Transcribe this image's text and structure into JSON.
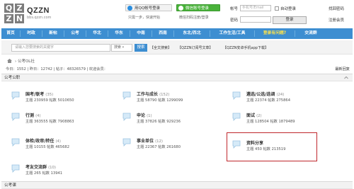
{
  "brand": {
    "logo_letters": [
      "Q",
      "Z",
      "Z",
      "N"
    ],
    "name": "QZZN",
    "url": "bbs.qzzn.com"
  },
  "social_login": {
    "qq_label": "用QQ帐号登录",
    "qq_note": "只需一步，快速开始",
    "wechat_label": "微信账号登录",
    "wechat_note": "微信扫码注册/登录"
  },
  "login_form": {
    "username_label": "帐号",
    "username_placeholder": "手机号/Email",
    "password_label": "密码",
    "auto_login_label": "自动登录",
    "submit_label": "登录",
    "forgot_password": "找回密码",
    "register": "注册会员"
  },
  "nav": {
    "items": [
      "首页",
      "时政",
      "新帖",
      "公考",
      "华北",
      "华东",
      "中南",
      "西南",
      "东北/西北",
      "工作生活/工具",
      "登录有问题?",
      "交流群"
    ]
  },
  "search": {
    "placeholder": "请输入您要搜索的关键字",
    "scope": "搜索",
    "button": "搜索",
    "links": [
      "【全文搜索】",
      "【QZZN订阅号文章】",
      "【QZZN安卓手机app下载】"
    ]
  },
  "breadcrumb": {
    "current": "公考OL社"
  },
  "stats": {
    "text": "今日：1552 | 昨日：12742 | 帖子：48326579 | 欢迎会员：",
    "hot": "最新回复"
  },
  "group": {
    "title": "公考公职",
    "next_title": "公考课"
  },
  "forums": [
    {
      "name": "国考/联考",
      "count": "(35)",
      "stats": "主题 230959  帖数 5010650"
    },
    {
      "name": "工作与成长",
      "count": "(152)",
      "stats": "主题 58790  帖数 1299099"
    },
    {
      "name": "遴选/公选/选调",
      "count": "(24)",
      "stats": "主题 22374  帖数 275864"
    },
    {
      "name": "行测",
      "count": "(4)",
      "stats": "主题 363555  帖数 7908863"
    },
    {
      "name": "申论",
      "count": "(1)",
      "stats": "主题 37826  帖数 929236"
    },
    {
      "name": "面试",
      "count": "(2)",
      "stats": "主题 128504  帖数 1879489"
    },
    {
      "name": "体检/政审/转任",
      "count": "(4)",
      "stats": "主题 10155  帖数 465682"
    },
    {
      "name": "事业单位",
      "count": "(12)",
      "stats": "主题 22367  帖数 261680"
    },
    {
      "name": "资料分享",
      "count": "",
      "stats": "主题 450  帖数 213519"
    },
    {
      "name": "考友交流群",
      "count": "(10)",
      "stats": "主题 265  帖数 13941"
    }
  ],
  "colors": {
    "nav": "#3d8ed1",
    "highlight_box": "#c0272d",
    "wechat": "#49b23a"
  }
}
